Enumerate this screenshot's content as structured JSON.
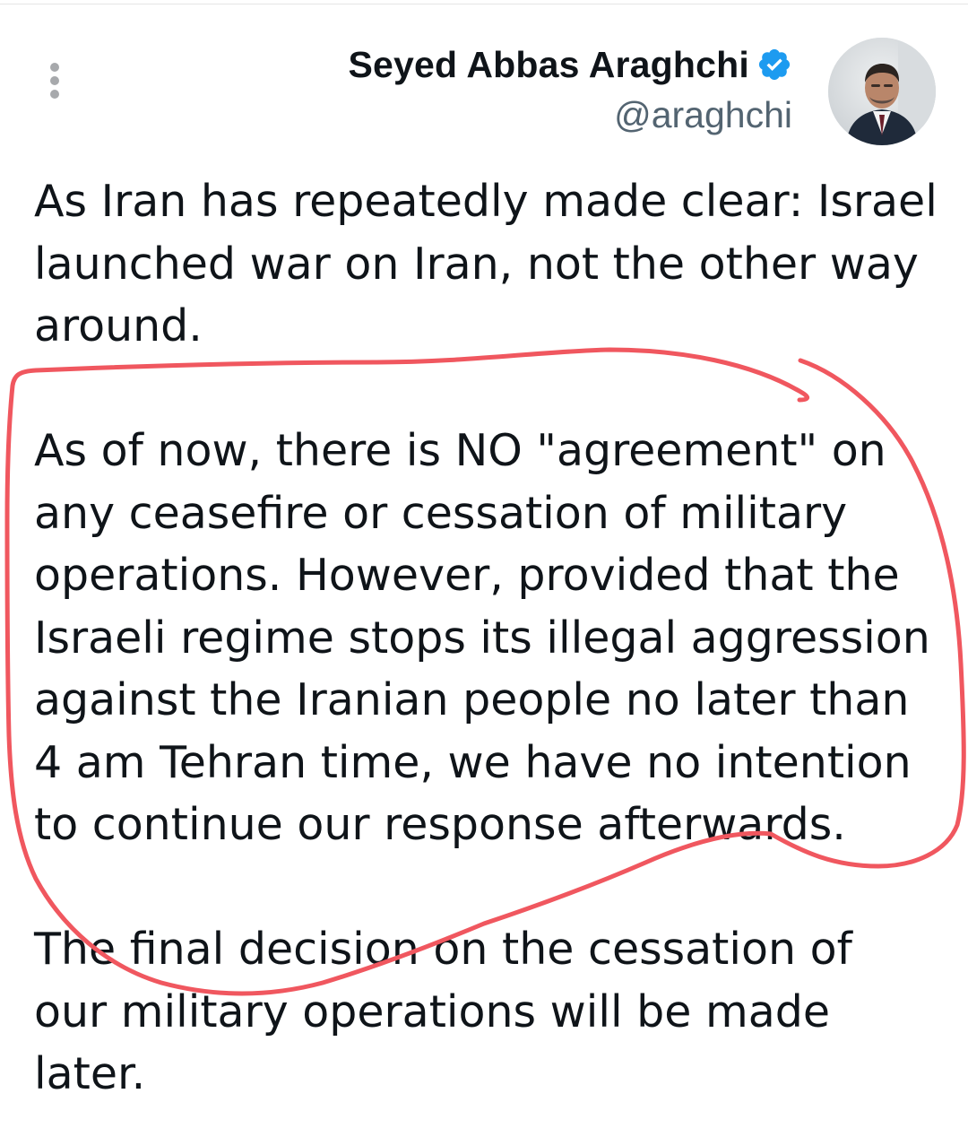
{
  "tweet": {
    "author": {
      "name": "Seyed Abbas Araghchi",
      "handle": "@araghchi",
      "verified": true,
      "verified_color": "#1d9bf0"
    },
    "paragraphs": [
      "As Iran has repeatedly made clear: Israel\nlaunched war on Iran, not the other way\naround.",
      "As of now, there is NO \"agreement\" on\nany ceasefire or cessation of military\noperations. However, provided that the\nIsraeli regime stops its illegal aggression\nagainst the Iranian people no later than\n4 am Tehran time, we have no intention\nto continue our response afterwards.",
      "The final decision on the cessation of\nour military operations will be made\nlater."
    ]
  },
  "icons": {
    "more": "more-vertical-icon",
    "verified": "verified-badge-icon"
  },
  "colors": {
    "text": "#0f1419",
    "handle": "#536471",
    "menu_dots": "#a7a9ac",
    "annotation_stroke": "#f0575f"
  }
}
